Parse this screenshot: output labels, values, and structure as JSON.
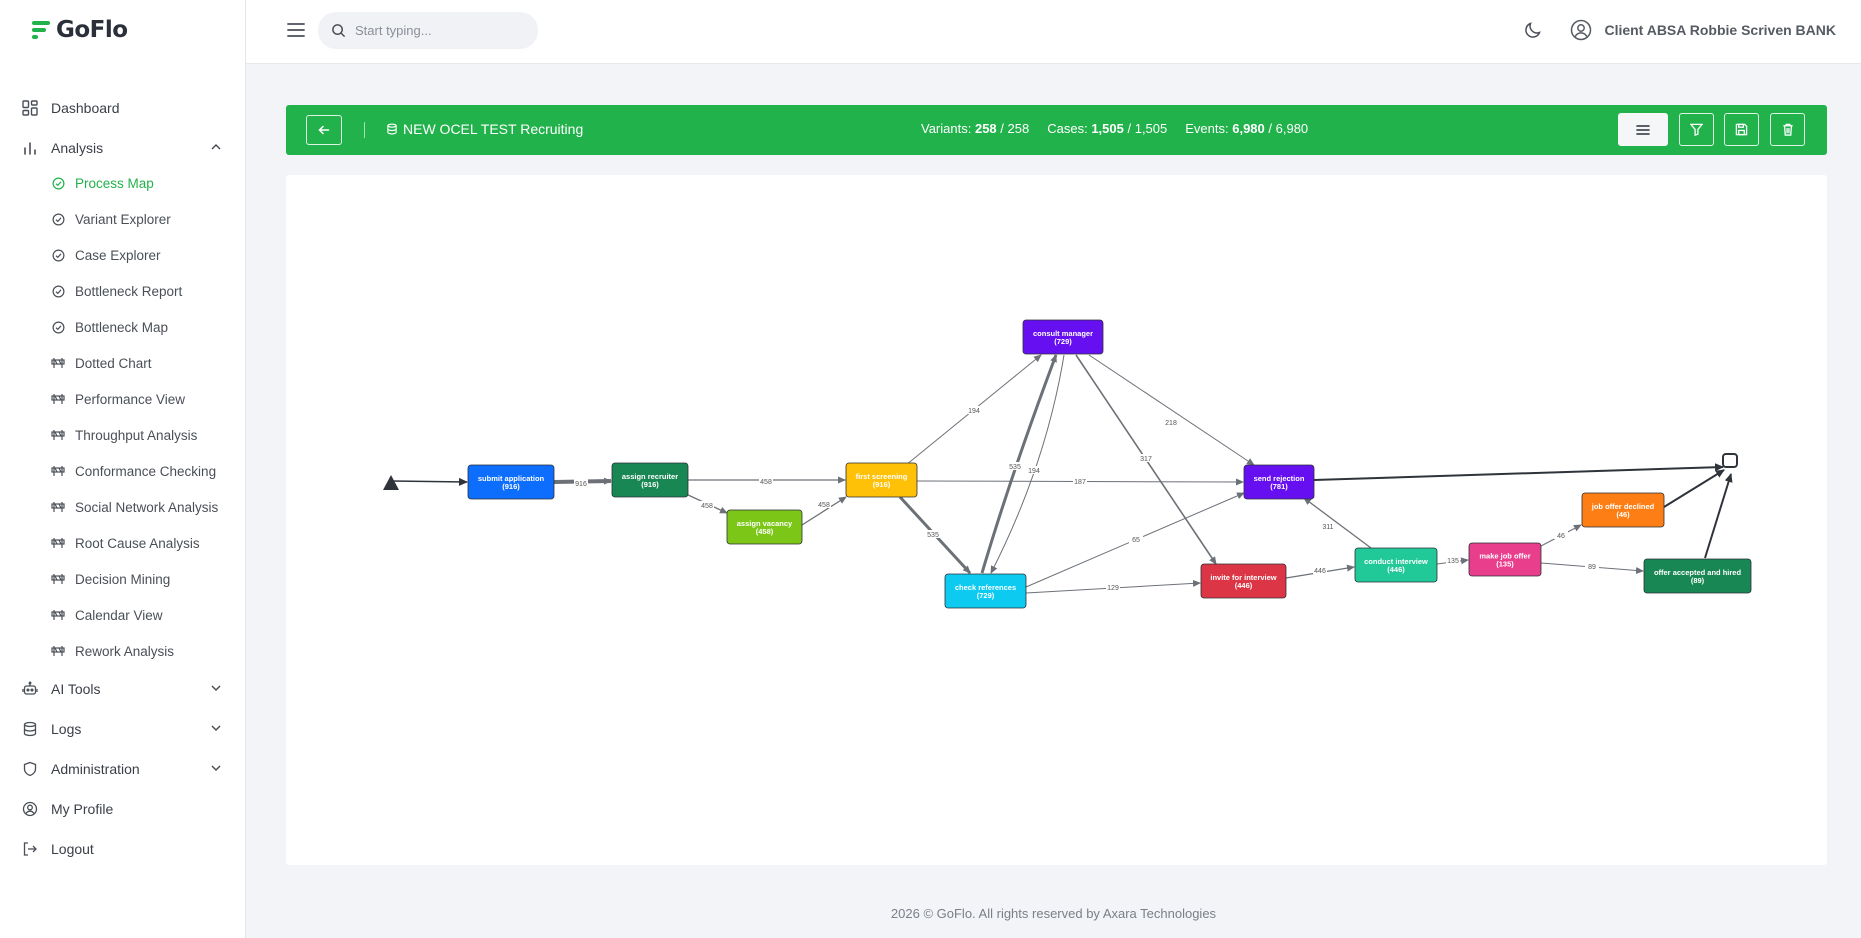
{
  "brand": {
    "name": "GoFlo",
    "color": "#22b24c"
  },
  "sidebar": {
    "items": [
      {
        "label": "Dashboard",
        "icon": "dashboard-icon"
      },
      {
        "label": "Analysis",
        "icon": "bar-chart-icon",
        "expanded": true
      },
      {
        "label": "AI Tools",
        "icon": "robot-icon"
      },
      {
        "label": "Logs",
        "icon": "database-icon"
      },
      {
        "label": "Administration",
        "icon": "shield-icon"
      },
      {
        "label": "My Profile",
        "icon": "user-circle-icon"
      },
      {
        "label": "Logout",
        "icon": "logout-icon"
      }
    ],
    "analysis_items": [
      {
        "label": "Process Map",
        "icon": "check-circle-icon",
        "active": true
      },
      {
        "label": "Variant Explorer",
        "icon": "check-circle-icon"
      },
      {
        "label": "Case Explorer",
        "icon": "check-circle-icon"
      },
      {
        "label": "Bottleneck Report",
        "icon": "check-circle-icon"
      },
      {
        "label": "Bottleneck Map",
        "icon": "check-circle-icon"
      },
      {
        "label": "Dotted Chart",
        "icon": "barrier-icon"
      },
      {
        "label": "Performance View",
        "icon": "barrier-icon"
      },
      {
        "label": "Throughput Analysis",
        "icon": "barrier-icon"
      },
      {
        "label": "Conformance Checking",
        "icon": "barrier-icon"
      },
      {
        "label": "Social Network Analysis",
        "icon": "barrier-icon"
      },
      {
        "label": "Root Cause Analysis",
        "icon": "barrier-icon"
      },
      {
        "label": "Decision Mining",
        "icon": "barrier-icon"
      },
      {
        "label": "Calendar View",
        "icon": "barrier-icon"
      },
      {
        "label": "Rework Analysis",
        "icon": "barrier-icon"
      }
    ]
  },
  "topbar": {
    "search_placeholder": "Start typing...",
    "user_name": "Client ABSA Robbie Scriven BANK"
  },
  "header": {
    "log_name": "NEW OCEL TEST Recruiting",
    "variants_label": "Variants:",
    "variants_value": "258",
    "variants_total": "/ 258",
    "cases_label": "Cases:",
    "cases_value": "1,505",
    "cases_total": "/ 1,505",
    "events_label": "Events:",
    "events_value": "6,980",
    "events_total": "/ 6,980"
  },
  "process_map": {
    "nodes": [
      {
        "id": "submit",
        "label": "submit application",
        "count": "(916)",
        "color": "#0d6efd"
      },
      {
        "id": "assign",
        "label": "assign recruiter",
        "count": "(916)",
        "color": "#198754"
      },
      {
        "id": "vacancy",
        "label": "assign vacancy",
        "count": "(458)",
        "color": "#7cc618"
      },
      {
        "id": "screening",
        "label": "first screening",
        "count": "(916)",
        "color": "#ffc107"
      },
      {
        "id": "consult",
        "label": "consult manager",
        "count": "(729)",
        "color": "#6610f2"
      },
      {
        "id": "references",
        "label": "check references",
        "count": "(729)",
        "color": "#0dcaf0"
      },
      {
        "id": "rejection",
        "label": "send rejection",
        "count": "(781)",
        "color": "#6610f2"
      },
      {
        "id": "invite",
        "label": "invite for interview",
        "count": "(446)",
        "color": "#dc3545"
      },
      {
        "id": "interview",
        "label": "conduct interview",
        "count": "(446)",
        "color": "#20c997"
      },
      {
        "id": "offer",
        "label": "make job offer",
        "count": "(135)",
        "color": "#e83e8c"
      },
      {
        "id": "declined",
        "label": "job offer declined",
        "count": "(46)",
        "color": "#fd7e14"
      },
      {
        "id": "hired",
        "label": "offer accepted and hired",
        "count": "(89)",
        "color": "#198754"
      }
    ],
    "edges": [
      {
        "from": "start",
        "to": "submit",
        "label": ""
      },
      {
        "from": "submit",
        "to": "assign",
        "label": "916"
      },
      {
        "from": "assign",
        "to": "screening",
        "label": "458"
      },
      {
        "from": "assign",
        "to": "vacancy",
        "label": "458"
      },
      {
        "from": "vacancy",
        "to": "screening",
        "label": "458"
      },
      {
        "from": "screening",
        "to": "consult",
        "label": "194"
      },
      {
        "from": "screening",
        "to": "rejection",
        "label": "187"
      },
      {
        "from": "screening",
        "to": "references",
        "label": "535"
      },
      {
        "from": "references",
        "to": "consult",
        "label": "535"
      },
      {
        "from": "consult",
        "to": "references",
        "label": "194"
      },
      {
        "from": "consult",
        "to": "rejection",
        "label": "218"
      },
      {
        "from": "consult",
        "to": "invite",
        "label": "317"
      },
      {
        "from": "references",
        "to": "rejection",
        "label": "65"
      },
      {
        "from": "references",
        "to": "invite",
        "label": "129"
      },
      {
        "from": "invite",
        "to": "interview",
        "label": "446"
      },
      {
        "from": "interview",
        "to": "rejection",
        "label": "311"
      },
      {
        "from": "interview",
        "to": "offer",
        "label": "135"
      },
      {
        "from": "offer",
        "to": "declined",
        "label": "46"
      },
      {
        "from": "offer",
        "to": "hired",
        "label": "89"
      },
      {
        "from": "rejection",
        "to": "end",
        "label": ""
      },
      {
        "from": "declined",
        "to": "end",
        "label": ""
      },
      {
        "from": "hired",
        "to": "end",
        "label": ""
      }
    ]
  },
  "footer": {
    "text": "2026 © GoFlo. All rights reserved by Axara Technologies"
  }
}
